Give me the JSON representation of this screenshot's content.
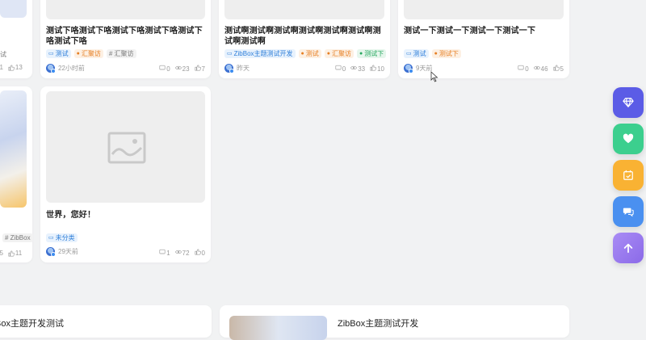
{
  "cards": [
    {
      "title": "测试下咯测试下咯测试下咯测试下咯测试下咯测试下咯",
      "tags": [
        {
          "label": "测试",
          "color": "blue",
          "icon": "folder-icon"
        },
        {
          "label": "汇聚访",
          "color": "orange",
          "icon": "bag-icon"
        },
        {
          "label": "# 汇聚访",
          "color": "plain",
          "icon": ""
        }
      ],
      "time": "22小时前",
      "comments": "0",
      "views": "23",
      "likes": "7"
    },
    {
      "title": "测试啊测试啊测试啊测试啊测试啊测试啊测试啊测试啊",
      "tags": [
        {
          "label": "ZibBox主题测试开发",
          "color": "blue",
          "icon": "folder-icon"
        },
        {
          "label": "测试",
          "color": "orange",
          "icon": "bag-icon"
        },
        {
          "label": "汇聚访",
          "color": "orange",
          "icon": "bag-icon"
        },
        {
          "label": "测试下",
          "color": "green",
          "icon": "check-icon"
        }
      ],
      "time": "昨天",
      "comments": "0",
      "views": "33",
      "likes": "10"
    },
    {
      "title": "测试一下测试一下测试一下测试一下",
      "tags": [
        {
          "label": "测试",
          "color": "blue",
          "icon": "folder-icon"
        },
        {
          "label": "测试下",
          "color": "orange",
          "icon": "bag-icon"
        }
      ],
      "time": "9天前",
      "comments": "0",
      "views": "46",
      "likes": "5"
    },
    {
      "title": "世界，您好！",
      "tags": [
        {
          "label": "未分类",
          "color": "blue",
          "icon": "folder-icon"
        }
      ],
      "time": "29天前",
      "comments": "1",
      "views": "72",
      "likes": "0"
    }
  ],
  "left_partial_top": {
    "views": "31",
    "likes": "13"
  },
  "left_partial_bottom": {
    "tag": "# ZibBox",
    "views": "75",
    "likes": "11"
  },
  "bottom_sections": [
    {
      "title": "Box主题开发测试"
    },
    {
      "title": "ZibBox主题测试开发"
    }
  ],
  "fab": [
    {
      "name": "vip-fab",
      "icon": "diamond-icon",
      "color": "#5b5ce6"
    },
    {
      "name": "favorite-fab",
      "icon": "heart-icon",
      "color": "#3ccf8e"
    },
    {
      "name": "checkin-fab",
      "icon": "calendar-icon",
      "color": "#f9b233"
    },
    {
      "name": "chat-fab",
      "icon": "chat-icon",
      "color": "#4a90f0"
    },
    {
      "name": "back-to-top-fab",
      "icon": "arrow-up-icon",
      "color": "#9b7cf0"
    }
  ]
}
